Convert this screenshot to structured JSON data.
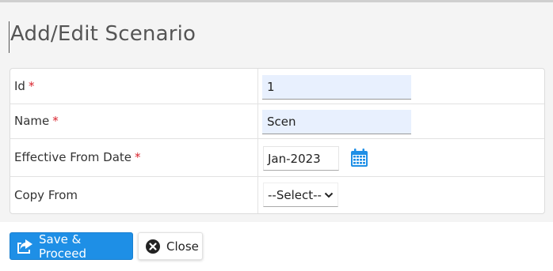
{
  "dialog": {
    "title": "Add/Edit Scenario"
  },
  "form": {
    "id": {
      "label": "Id",
      "required_mark": "*",
      "value": "1"
    },
    "name": {
      "label": "Name",
      "required_mark": "*",
      "value": "Scen"
    },
    "effective_from": {
      "label": "Effective From Date",
      "required_mark": "*",
      "value": "Jan-2023",
      "icon": "calendar-icon"
    },
    "copy_from": {
      "label": "Copy From",
      "selected": "--Select--"
    }
  },
  "footer": {
    "save_label": "Save & Proceed",
    "save_icon": "share-icon",
    "close_label": "Close",
    "close_icon": "close-circle-icon"
  },
  "colors": {
    "primary": "#1e8fe6",
    "required": "#d9232d",
    "input_fill": "#e8f0fe"
  }
}
